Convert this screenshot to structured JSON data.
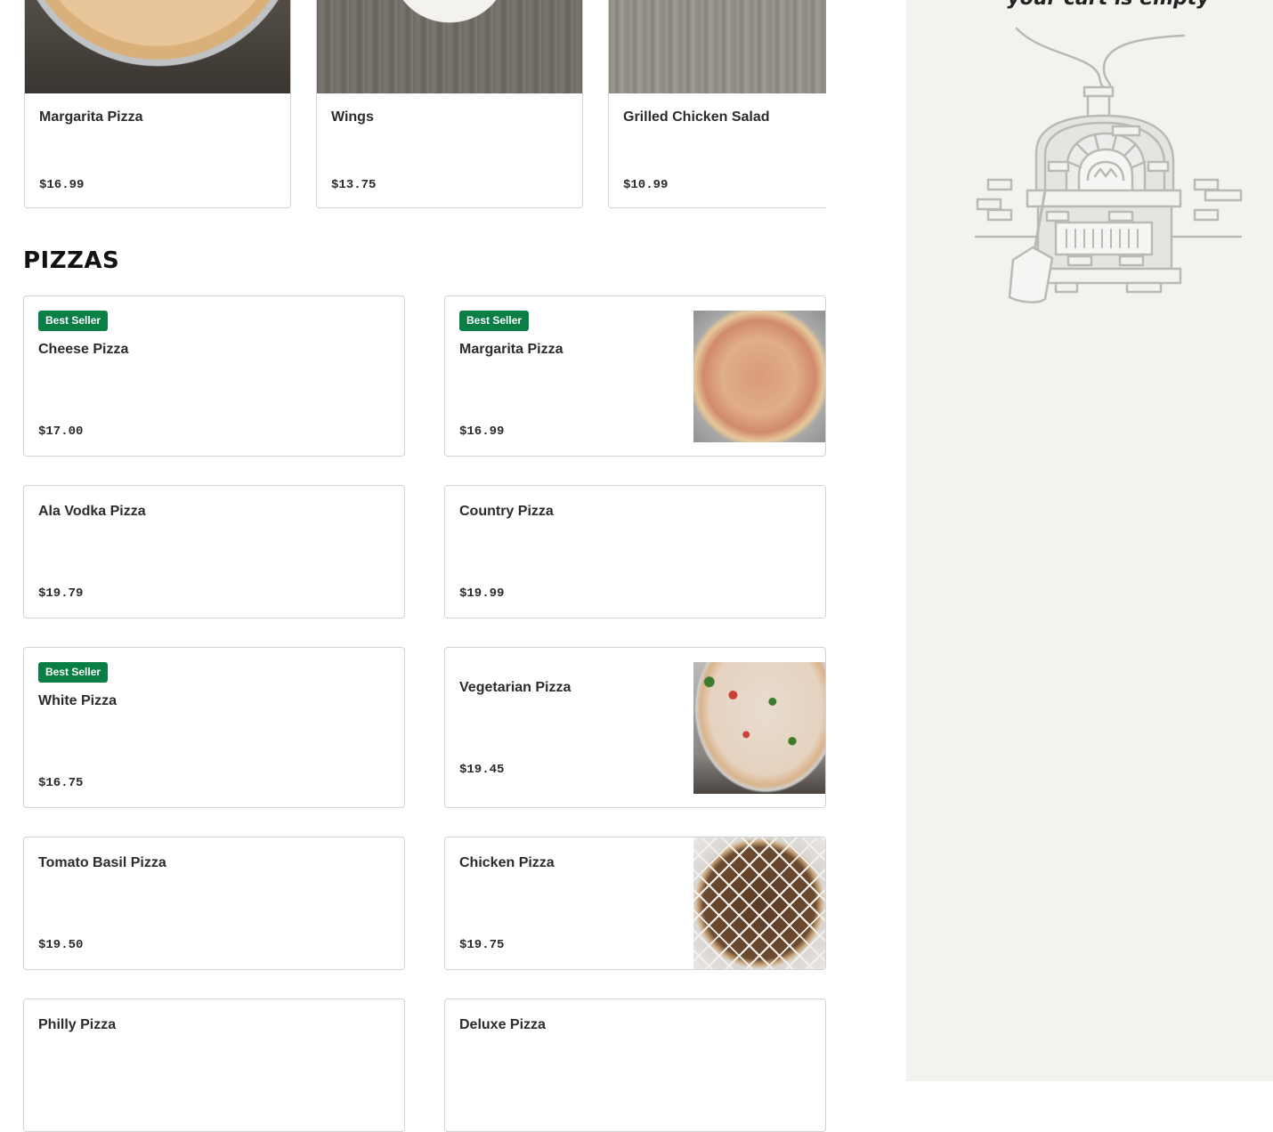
{
  "featured": [
    {
      "name": "Margarita Pizza",
      "price": "$16.99"
    },
    {
      "name": "Wings",
      "price": "$13.75"
    },
    {
      "name": "Grilled Chicken Salad",
      "price": "$10.99"
    }
  ],
  "section": {
    "title": "PIZZAS"
  },
  "badge_label": "Best Seller",
  "pizzas": [
    {
      "name": "Cheese Pizza",
      "price": "$17.00",
      "badge": true,
      "image": false
    },
    {
      "name": "Margarita Pizza",
      "price": "$16.99",
      "badge": true,
      "image": true
    },
    {
      "name": "Ala Vodka Pizza",
      "price": "$19.79",
      "badge": false,
      "image": false
    },
    {
      "name": "Country Pizza",
      "price": "$19.99",
      "badge": false,
      "image": false
    },
    {
      "name": "White Pizza",
      "price": "$16.75",
      "badge": true,
      "image": false
    },
    {
      "name": "Vegetarian Pizza",
      "price": "$19.45",
      "badge": false,
      "image": true
    },
    {
      "name": "Tomato Basil Pizza",
      "price": "$19.50",
      "badge": false,
      "image": false
    },
    {
      "name": "Chicken Pizza",
      "price": "$19.75",
      "badge": false,
      "image": true
    },
    {
      "name": "Philly Pizza",
      "price": "",
      "badge": false,
      "image": false
    },
    {
      "name": "Deluxe Pizza",
      "price": "",
      "badge": false,
      "image": false
    }
  ],
  "cart": {
    "empty_text": "your cart is empty",
    "illustration": "pizza-oven-icon"
  },
  "colors": {
    "badge": "#0a7f45",
    "cart_bg": "#f2f2ef",
    "border": "#d3d3d3"
  }
}
